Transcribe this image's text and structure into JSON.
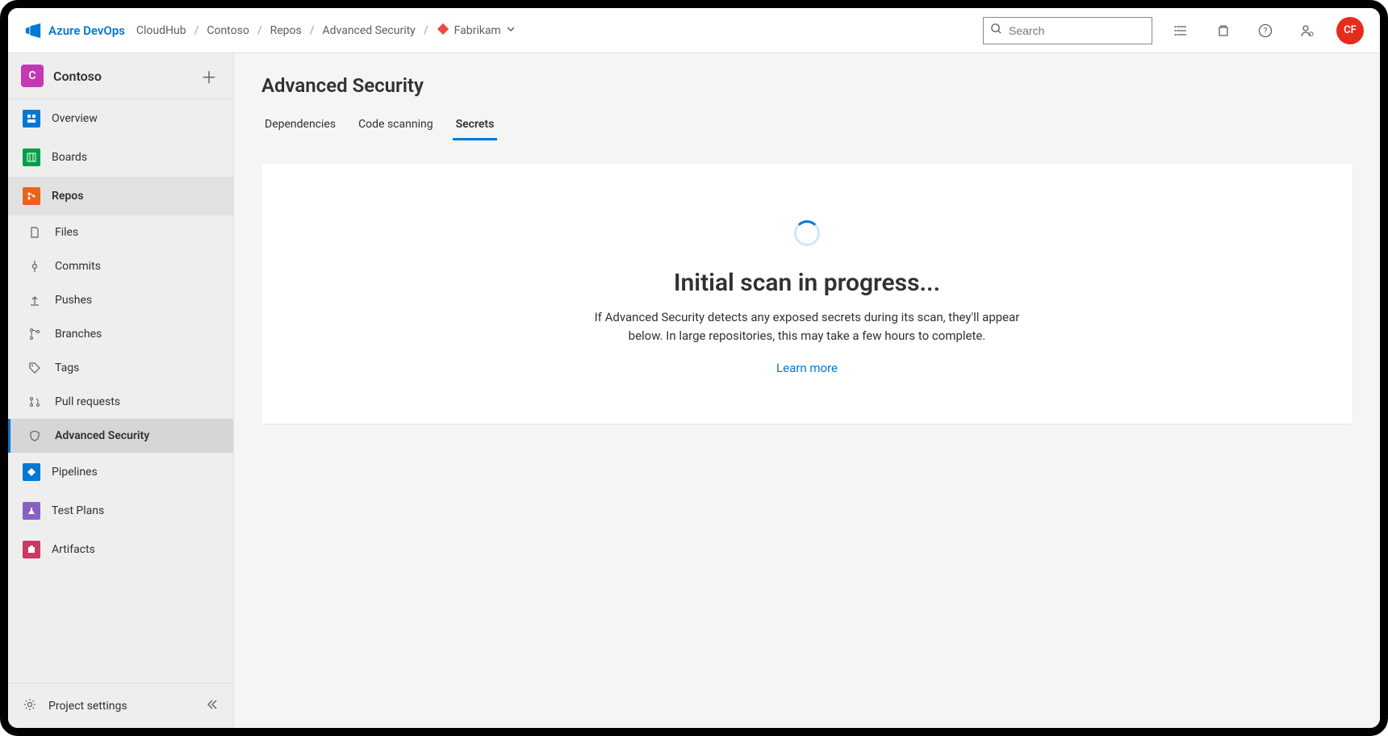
{
  "brand": {
    "name": "Azure DevOps"
  },
  "breadcrumbs": {
    "items": [
      "CloudHub",
      "Contoso",
      "Repos",
      "Advanced Security"
    ],
    "repo": "Fabrikam"
  },
  "search": {
    "placeholder": "Search"
  },
  "user": {
    "initials": "CF"
  },
  "project": {
    "initial": "C",
    "name": "Contoso"
  },
  "sidebar": {
    "overview": "Overview",
    "boards": "Boards",
    "repos": "Repos",
    "files": "Files",
    "commits": "Commits",
    "pushes": "Pushes",
    "branches": "Branches",
    "tags": "Tags",
    "pull_requests": "Pull requests",
    "advanced_security": "Advanced Security",
    "pipelines": "Pipelines",
    "test_plans": "Test Plans",
    "artifacts": "Artifacts",
    "project_settings": "Project settings"
  },
  "page": {
    "title": "Advanced Security",
    "tabs": {
      "dependencies": "Dependencies",
      "code_scanning": "Code scanning",
      "secrets": "Secrets"
    },
    "status_heading": "Initial scan in progress...",
    "status_text": "If Advanced Security detects any exposed secrets during its scan, they'll appear below. In large repositories, this may take a few hours to complete.",
    "learn_more": "Learn more"
  }
}
